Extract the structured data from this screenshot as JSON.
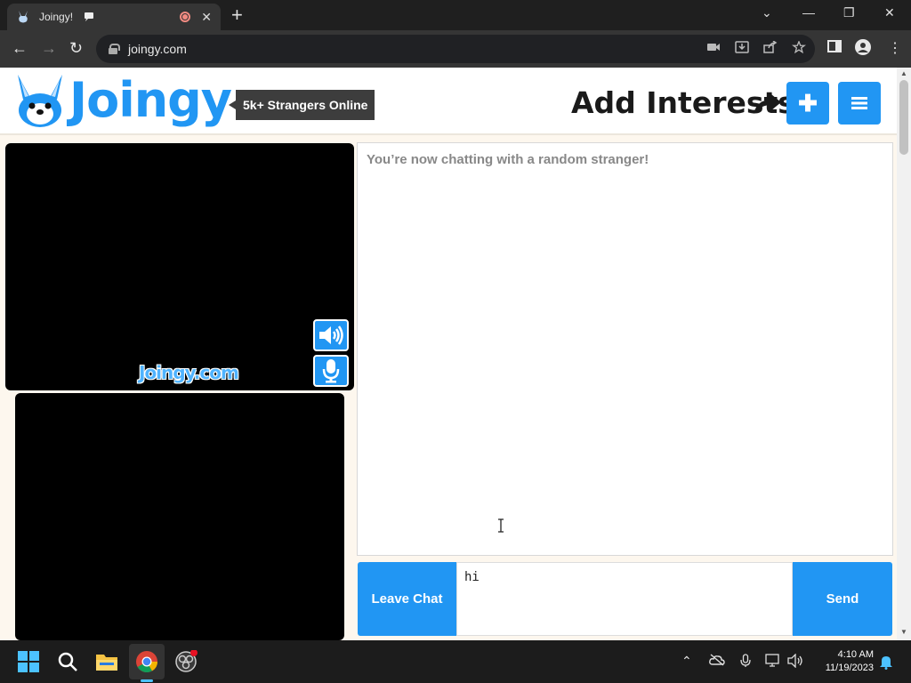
{
  "browser": {
    "tab_title": "Joingy!",
    "new_tab_icon": "plus-icon",
    "url": "joingy.com",
    "window_controls": [
      "chevron-down-icon",
      "minimize-icon",
      "restore-icon",
      "close-icon"
    ]
  },
  "site": {
    "logo_text": "Joingy",
    "online_badge": "5k+ Strangers Online",
    "add_interests": "Add Interests",
    "plus_icon": "plus-icon",
    "menu_icon": "hamburger-menu-icon",
    "watermark": "Joingy.com",
    "colors": {
      "accent": "#2196f3",
      "page_bg": "#fdf7ee",
      "badge_bg": "#3d3d3d"
    }
  },
  "chat": {
    "system_message": "You’re now chatting with a random stranger!",
    "leave_label": "Leave Chat",
    "send_label": "Send",
    "input_value": "hi"
  },
  "taskbar": {
    "time": "4:10 AM",
    "date": "11/19/2023",
    "apps": [
      "windows-start-icon",
      "search-icon",
      "file-explorer-icon",
      "chrome-icon",
      "obs-icon"
    ]
  }
}
